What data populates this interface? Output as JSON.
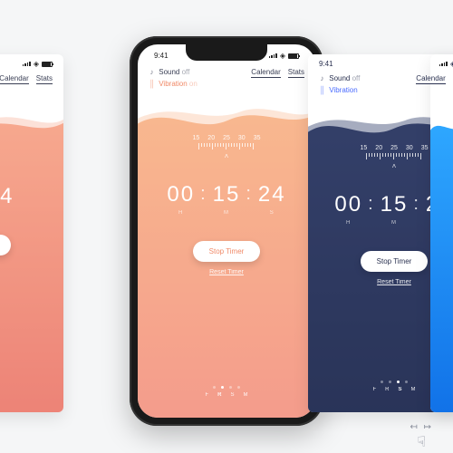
{
  "status": {
    "time_text": "9:41"
  },
  "nav": {
    "calendar": "Calendar",
    "stats": "Stats"
  },
  "toggles": {
    "sound_label": "Sound",
    "sound_state": "off",
    "vibration_label": "Vibration",
    "vibration_state": "on"
  },
  "ruler": {
    "labels": [
      "15",
      "20",
      "25",
      "30",
      "35"
    ]
  },
  "timer": {
    "hours": "00",
    "minutes": "15",
    "seconds": "24",
    "h_label": "H",
    "m_label": "M",
    "s_label": "S"
  },
  "buttons": {
    "stop": "Stop Timer",
    "reset": "Reset Timer"
  },
  "pager": {
    "modes": [
      "F",
      "R",
      "S",
      "M"
    ],
    "screens": [
      {
        "active_mode_index": 1,
        "dots_count": 4,
        "active_dot": 1,
        "theme": "coral"
      },
      {
        "active_mode_index": 1,
        "dots_count": 4,
        "active_dot": 1,
        "theme": "peach"
      },
      {
        "active_mode_index": 2,
        "dots_count": 4,
        "active_dot": 2,
        "theme": "navy"
      },
      {
        "active_mode_index": 3,
        "dots_count": 4,
        "active_dot": 3,
        "theme": "blue"
      }
    ]
  },
  "themes": {
    "coral": {
      "top": "#f7a88e",
      "bottom": "#e86f6a",
      "button_text": "#e86f6a"
    },
    "peach": {
      "top": "#f8b88f",
      "bottom": "#f28e8a",
      "button_text": "#f08a68"
    },
    "navy": {
      "top": "#2f3a63",
      "bottom": "#1d2545",
      "button_text": "#2a3150"
    },
    "blue": {
      "top": "#2ea7ff",
      "bottom": "#1172e8",
      "button_text": "#1172e8"
    }
  },
  "chart_data": {
    "type": "line",
    "note": "decorative layered wave backdrop; no numeric axes",
    "series": []
  }
}
